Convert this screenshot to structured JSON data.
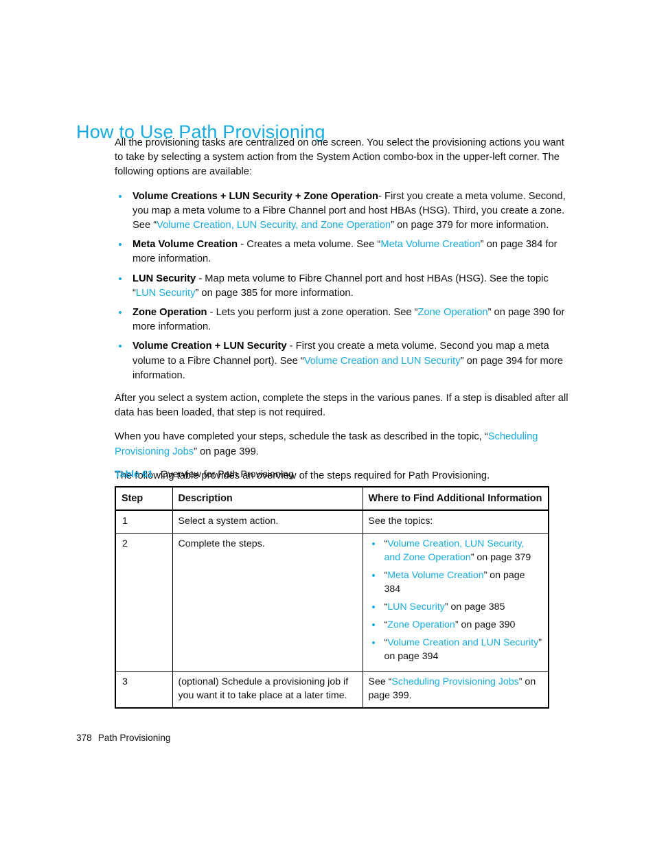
{
  "colors": {
    "accent": "#16ACE3",
    "text": "#111111",
    "rule": "#000000",
    "page_background": "#FFFFFF"
  },
  "heading": {
    "title": "How to Use Path Provisioning"
  },
  "intro": {
    "paragraph": "All the provisioning tasks are centralized on one screen. You select the provisioning actions you want to take by selecting a system action from the System Action combo-box in the upper-left corner. The following options are available:"
  },
  "options": [
    {
      "term": "Volume Creations + LUN Security + Zone Operation",
      "text_before_link": "- First you create a meta volume. Second, you map a meta volume to a Fibre Channel port and host HBAs (HSG). Third, you create a zone. See “",
      "link": "Volume Creation, LUN Security, and Zone Operation",
      "text_after_link": "” on page 379 for more information."
    },
    {
      "term": "Meta Volume Creation",
      "text_before_link": " - Creates a meta volume. See “",
      "link": "Meta Volume Creation",
      "text_after_link": "” on page 384 for more information."
    },
    {
      "term": "LUN Security",
      "text_before_link": " - Map meta volume to Fibre Channel port and host HBAs (HSG). See the topic “",
      "link": "LUN Security",
      "text_after_link": "” on page 385 for more information."
    },
    {
      "term": "Zone Operation",
      "text_before_link": " - Lets you perform just a zone operation. See “",
      "link": "Zone Operation",
      "text_after_link": "” on page 390 for more information."
    },
    {
      "term": "Volume Creation + LUN Security",
      "text_before_link": " - First you create a meta volume. Second you map a meta volume to a Fibre Channel port). See “",
      "link": "Volume Creation and LUN Security",
      "text_after_link": "” on page 394 for more information."
    }
  ],
  "closing": {
    "paragraph_1": "After you select a system action, complete the steps in the various panes. If a step is disabled after all data has been loaded, that step is not required.",
    "paragraph_2_before": "When you have completed your steps, schedule the task as described in the topic, “",
    "paragraph_2_link": "Scheduling Provisioning Jobs",
    "paragraph_2_after": "” on page 399.",
    "paragraph_3": "The following table provides an overview of the steps required for Path Provisioning."
  },
  "table": {
    "caption_number": "Table 61",
    "caption_text": "Overview for Path Provisioning",
    "headers": [
      "Step",
      "Description",
      "Where to Find Additional Information"
    ],
    "rows": [
      {
        "step": "1",
        "description": "Select a system action.",
        "info_lead": "See the topics:",
        "info_items": []
      },
      {
        "step": "2",
        "description": "Complete the steps.",
        "info_lead": "",
        "info_items": [
          {
            "before": "“",
            "link": "Volume Creation, LUN Security, and Zone Operation",
            "after": "” on page 379"
          },
          {
            "before": "“",
            "link": "Meta Volume Creation",
            "after": "” on page 384"
          },
          {
            "before": "“",
            "link": "LUN Security",
            "after": "” on page 385"
          },
          {
            "before": "“",
            "link": "Zone Operation",
            "after": "” on page 390"
          },
          {
            "before": "“",
            "link": "Volume Creation and LUN Security",
            "after": "” on page 394"
          }
        ]
      },
      {
        "step": "3",
        "description": "(optional) Schedule a provisioning job if you want it to take place at a later time.",
        "info_lead_before": "See “",
        "info_lead_link": "Scheduling Provisioning Jobs",
        "info_lead_after": "” on page 399.",
        "info_items": []
      }
    ]
  },
  "footer": {
    "page_number": "378",
    "section": "Path Provisioning"
  }
}
